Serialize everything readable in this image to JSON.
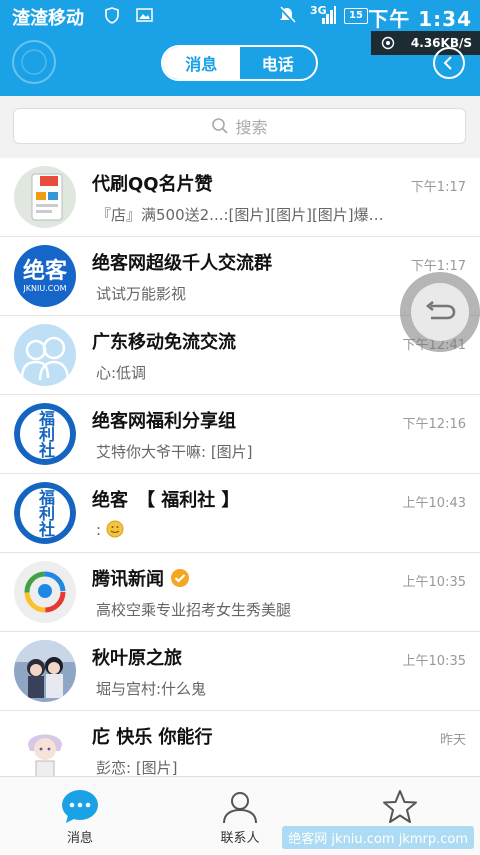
{
  "status_bar": {
    "carrier": "渣渣移动",
    "network": "3G",
    "battery": "15",
    "time": "下午 1:34",
    "speed": "4.36KB/S"
  },
  "header": {
    "tabs": [
      {
        "label": "消息",
        "active": true
      },
      {
        "label": "电话",
        "active": false
      }
    ]
  },
  "search": {
    "placeholder": "搜索"
  },
  "conversations": [
    {
      "name": "代刷QQ名片赞",
      "message": "『店』满500送2...:[图片][图片][图片]爆…",
      "time": "下午1:17"
    },
    {
      "name": "绝客网超级千人交流群",
      "message": "试试万能影视",
      "time": "下午1:17",
      "avatar_text": "绝客",
      "avatar_sub": "JKNIU.COM"
    },
    {
      "name": "广东移动免流交流",
      "message": "心:低调",
      "time": "下午12:41"
    },
    {
      "name": " 绝客网福利分享组",
      "message": "艾特你大爷干嘛: [图片]",
      "time": "下午12:16",
      "avatar_text": "福利社"
    },
    {
      "name": "绝客　【 福利社 】",
      "message": ":",
      "time": "上午10:43",
      "avatar_text": "福利社"
    },
    {
      "name": "腾讯新闻",
      "message": "高校空乘专业招考女生秀美腿",
      "time": "上午10:35"
    },
    {
      "name": "秋叶原之旅",
      "message": "堀与宫村:什么鬼",
      "time": "上午10:35"
    },
    {
      "name": "庀 快乐  你能行",
      "message": "彭恋: [图片]",
      "time": "昨天"
    }
  ],
  "tab_bar": {
    "items": [
      {
        "label": "消息",
        "icon": "chat-bubble-icon",
        "active": true
      },
      {
        "label": "联系人",
        "icon": "person-icon",
        "active": false
      },
      {
        "label": "",
        "icon": "star-icon",
        "active": false
      }
    ]
  },
  "watermark": "绝客网 jkniu.com jkmrp.com",
  "colors": {
    "primary": "#1aa1e6",
    "background": "#ffffff",
    "fuli_blue": "#1565c0"
  }
}
